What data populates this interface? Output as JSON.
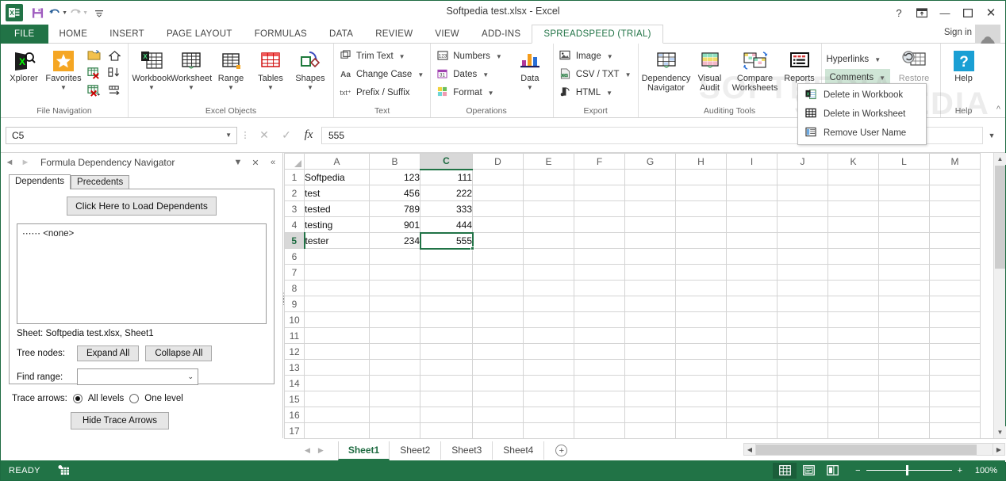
{
  "window": {
    "title": "Softpedia test.xlsx - Excel",
    "help_icon": "?",
    "ribbon_display_icon": "ribbon-display-options",
    "minimize_icon": "—",
    "maximize_icon": "▢",
    "close_icon": "✕",
    "sign_in": "Sign in"
  },
  "quick_access": {
    "logo": "X",
    "save_label": "save-icon",
    "undo_label": "undo-icon",
    "redo_label": "redo-icon",
    "customize_label": "customize-icon"
  },
  "ribbon_tabs": [
    {
      "label": "FILE",
      "active": false
    },
    {
      "label": "HOME",
      "active": false
    },
    {
      "label": "INSERT",
      "active": false
    },
    {
      "label": "PAGE LAYOUT",
      "active": false
    },
    {
      "label": "FORMULAS",
      "active": false
    },
    {
      "label": "DATA",
      "active": false
    },
    {
      "label": "REVIEW",
      "active": false
    },
    {
      "label": "VIEW",
      "active": false
    },
    {
      "label": "ADD-INS",
      "active": false
    },
    {
      "label": "SPREADSPEED (TRIAL)",
      "active": true
    }
  ],
  "ribbon": {
    "groups": [
      {
        "name": "File Navigation",
        "label": "File Navigation",
        "big": [
          {
            "label": "Xplorer",
            "icon": "xplorer-icon",
            "caret": false
          },
          {
            "label": "Favorites",
            "icon": "favorites-star-icon",
            "caret": true
          }
        ],
        "grid_icons": [
          "open-folder-icon",
          "home-icon",
          "close-workbook-icon",
          "move-down-icon",
          "close-worksheet-icon",
          "move-right-icon"
        ]
      },
      {
        "name": "Excel Objects",
        "label": "Excel Objects",
        "big": [
          {
            "label": "Workbook",
            "icon": "workbook-icon",
            "caret": true
          },
          {
            "label": "Worksheet",
            "icon": "worksheet-icon",
            "caret": true
          },
          {
            "label": "Range",
            "icon": "range-icon",
            "caret": true
          },
          {
            "label": "Tables",
            "icon": "tables-icon",
            "caret": true
          },
          {
            "label": "Shapes",
            "icon": "shapes-icon",
            "caret": true
          }
        ]
      },
      {
        "name": "Text",
        "label": "Text",
        "small": [
          {
            "label": "Trim Text",
            "icon": "trim-text-icon",
            "caret": true
          },
          {
            "label": "Change Case",
            "icon": "change-case-icon",
            "caret": true
          },
          {
            "label": "Prefix / Suffix",
            "icon": "prefix-suffix-icon",
            "caret": false
          }
        ]
      },
      {
        "name": "Operations",
        "label": "Operations",
        "small": [
          {
            "label": "Numbers",
            "icon": "numbers-icon",
            "caret": true
          },
          {
            "label": "Dates",
            "icon": "dates-calendar-icon",
            "caret": true
          },
          {
            "label": "Format",
            "icon": "format-swatch-icon",
            "caret": true
          }
        ],
        "big": [
          {
            "label": "Data",
            "icon": "data-chart-icon",
            "caret": true
          }
        ]
      },
      {
        "name": "Export",
        "label": "Export",
        "small": [
          {
            "label": "Image",
            "icon": "image-icon",
            "caret": true
          },
          {
            "label": "CSV / TXT",
            "icon": "csv-txt-icon",
            "caret": true
          },
          {
            "label": "HTML",
            "icon": "html-icon",
            "caret": true
          }
        ]
      },
      {
        "name": "Auditing Tools",
        "label": "Auditing Tools",
        "big": [
          {
            "label": "Dependency Navigator",
            "icon": "dependency-navigator-icon",
            "caret": false
          },
          {
            "label": "Visual Audit",
            "icon": "visual-audit-icon",
            "caret": false
          },
          {
            "label": "Compare Worksheets",
            "icon": "compare-worksheets-icon",
            "caret": false
          },
          {
            "label": "Reports",
            "icon": "reports-icon",
            "caret": true
          }
        ]
      },
      {
        "name": "Workbook Tools",
        "label": "lp",
        "small": [
          {
            "label": "Hyperlinks",
            "icon": "hyperlinks-icon",
            "caret": true
          },
          {
            "label": "Comments",
            "icon": "comments-icon",
            "caret": true
          }
        ],
        "big": [
          {
            "label": "Restore",
            "icon": "restore-icon",
            "caret": false
          }
        ]
      },
      {
        "name": "Help",
        "label": "Help",
        "big": [
          {
            "label": "Help",
            "icon": "help-question-icon",
            "caret": false
          }
        ]
      }
    ],
    "collapse_icon": "collapse-ribbon-icon"
  },
  "comments_menu": {
    "open": true,
    "items": [
      {
        "label": "Delete in Workbook",
        "icon": "delete-in-workbook-icon"
      },
      {
        "label": "Delete in Worksheet",
        "icon": "delete-in-worksheet-icon"
      },
      {
        "label": "Remove User Name",
        "icon": "remove-user-name-icon"
      }
    ]
  },
  "formula_bar": {
    "name_box": "C5",
    "cancel_icon": "✕",
    "enter_icon": "✓",
    "fx_icon": "fx",
    "value": "555",
    "expand_icon": "expand-formula-bar-icon"
  },
  "task_pane": {
    "title": "Formula Dependency Navigator",
    "back_icon": "back-arrow-icon",
    "forward_icon": "forward-arrow-icon",
    "options_icon": "▼",
    "close_icon": "✕",
    "collapse_icon": "«",
    "tabs": [
      {
        "label": "Dependents",
        "active": true
      },
      {
        "label": "Precedents",
        "active": false
      }
    ],
    "load_button": "Click Here to Load Dependents",
    "tree_node": "⋯⋯ <none>",
    "sheet_line": "Sheet: Softpedia test.xlsx, Sheet1",
    "tree_nodes_label": "Tree nodes:",
    "expand_all": "Expand All",
    "collapse_all": "Collapse All",
    "find_range_label": "Find range:",
    "find_range_value": "",
    "trace_arrows_label": "Trace arrows:",
    "trace_all_levels": "All levels",
    "trace_one_level": "One level",
    "trace_selected": "All levels",
    "hide_trace_button": "Hide Trace Arrows"
  },
  "grid": {
    "columns": [
      "A",
      "B",
      "C",
      "D",
      "E",
      "F",
      "G",
      "H",
      "I",
      "J",
      "K",
      "L",
      "M"
    ],
    "selected_column": "C",
    "selected_row": 5,
    "selected_cell": "C5",
    "rows": [
      {
        "num": 1,
        "cells": {
          "A": "Softpedia",
          "B": "123",
          "C": "111"
        }
      },
      {
        "num": 2,
        "cells": {
          "A": "test",
          "B": "456",
          "C": "222"
        }
      },
      {
        "num": 3,
        "cells": {
          "A": "tested",
          "B": "789",
          "C": "333"
        }
      },
      {
        "num": 4,
        "cells": {
          "A": "testing",
          "B": "901",
          "C": "444"
        }
      },
      {
        "num": 5,
        "cells": {
          "A": "tester",
          "B": "234",
          "C": "555"
        }
      },
      {
        "num": 6,
        "cells": {}
      },
      {
        "num": 7,
        "cells": {}
      },
      {
        "num": 8,
        "cells": {}
      },
      {
        "num": 9,
        "cells": {}
      },
      {
        "num": 10,
        "cells": {}
      },
      {
        "num": 11,
        "cells": {}
      },
      {
        "num": 12,
        "cells": {}
      },
      {
        "num": 13,
        "cells": {}
      },
      {
        "num": 14,
        "cells": {}
      },
      {
        "num": 15,
        "cells": {}
      },
      {
        "num": 16,
        "cells": {}
      },
      {
        "num": 17,
        "cells": {}
      }
    ]
  },
  "sheet_tabs": {
    "prev_icon": "◀",
    "next_icon": "▶",
    "tabs": [
      {
        "label": "Sheet1",
        "active": true
      },
      {
        "label": "Sheet2",
        "active": false
      },
      {
        "label": "Sheet3",
        "active": false
      },
      {
        "label": "Sheet4",
        "active": false
      }
    ],
    "add_icon": "+"
  },
  "status_bar": {
    "state": "READY",
    "macro_icon": "record-macro-icon",
    "views": [
      {
        "name": "normal-view",
        "icon": "▦",
        "active": true
      },
      {
        "name": "page-layout-view",
        "icon": "▤",
        "active": false
      },
      {
        "name": "page-break-view",
        "icon": "▥",
        "active": false
      }
    ],
    "zoom_out": "−",
    "zoom_in": "+",
    "zoom_level": "100%"
  },
  "watermark": {
    "text": "SOFTPEDIA"
  },
  "colors": {
    "excel_green": "#217346",
    "accent_green": "#1e6b41",
    "ribbon_border": "#d4d4d4",
    "selection_green": "#217346",
    "comments_highlight": "#cfe5d6"
  }
}
